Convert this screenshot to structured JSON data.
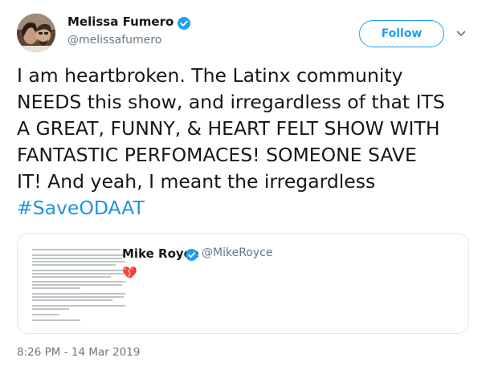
{
  "author": {
    "display_name": "Melissa Fumero",
    "handle": "@melissafumero",
    "verified_icon": "verified-badge-icon",
    "avatar": "avatar"
  },
  "follow_button": {
    "label": "Follow"
  },
  "more_menu": {
    "icon": "chevron-down-icon"
  },
  "tweet": {
    "lines": [
      "I am heartbroken. The Latinx community",
      "NEEDS this show, and irregardless of that ITS",
      "A GREAT, FUNNY, & HEART FELT SHOW WITH",
      "FANTASTIC PERFOMACES! SOMEONE SAVE",
      "IT! And yeah, I meant the irregardless"
    ],
    "hashtag": "#SaveODAAT"
  },
  "quoted_tweet": {
    "display_name": "Mike Royce",
    "handle": "@MikeRoyce",
    "content_icon": "broken-heart-icon",
    "content_text": "💔"
  },
  "timestamp": "8:26 PM - 14 Mar 2019",
  "colors": {
    "accent": "#1da1f2",
    "hashtag": "#1b95e0",
    "text": "#14171a",
    "secondary_text": "#657786",
    "border": "#e1e8ed",
    "broken_heart": "#e0245e"
  }
}
